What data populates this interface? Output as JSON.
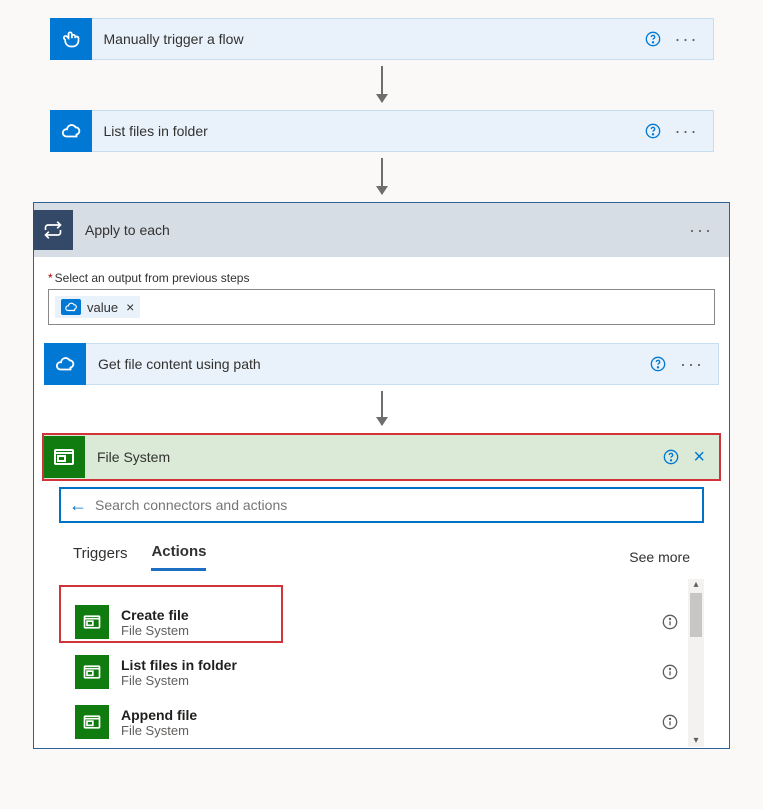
{
  "trigger": {
    "title": "Manually trigger a flow"
  },
  "listFiles": {
    "title": "List files in folder"
  },
  "apply": {
    "title": "Apply to each",
    "inputLabel": "Select an output from previous steps",
    "token": {
      "label": "value"
    }
  },
  "getContent": {
    "title": "Get file content using path"
  },
  "fileSystem": {
    "title": "File System"
  },
  "picker": {
    "searchPlaceholder": "Search connectors and actions",
    "tabs": {
      "triggers": "Triggers",
      "actions": "Actions"
    },
    "seeMore": "See more",
    "actions": [
      {
        "title": "Create file",
        "sub": "File System"
      },
      {
        "title": "List files in folder",
        "sub": "File System"
      },
      {
        "title": "Append file",
        "sub": "File System"
      }
    ]
  }
}
